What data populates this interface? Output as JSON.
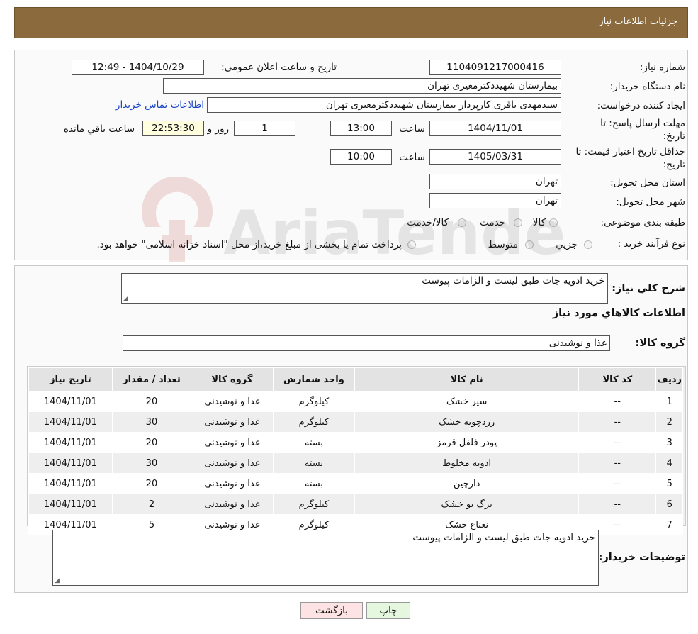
{
  "header": {
    "title": "جزئیات اطلاعات نیاز"
  },
  "form": {
    "need_number_label": "شماره نیاز:",
    "need_number": "1104091217000416",
    "announce_label": "تاریخ و ساعت اعلان عمومی:",
    "announce_value": "1404/10/29 - 12:49",
    "buyer_org_label": "نام دستگاه خریدار:",
    "buyer_org": "بیمارستان شهیددکترمعیری تهران",
    "requester_label": "ایجاد کننده درخواست:",
    "requester": "سیدمهدی باقری کارپرداز بیمارستان شهیددکترمعیری تهران",
    "contact_link": "اطلاعات تماس خریدار",
    "deadline_label_1": "مهلت ارسال پاسخ: تا",
    "deadline_label_2": "تاریخ:",
    "deadline_date": "1404/11/01",
    "time_label": "ساعت",
    "deadline_time": "13:00",
    "days_value": "1",
    "days_label": "روز و",
    "remaining_time": "22:53:30",
    "remaining_label": "ساعت باقي مانده",
    "validity_label_1": "حداقل تاریخ اعتبار قیمت: تا",
    "validity_label_2": "تاریخ:",
    "validity_date": "1405/03/31",
    "validity_time": "10:00",
    "province_label": "استان محل تحویل:",
    "province": "تهران",
    "city_label": "شهر محل تحویل:",
    "city": "تهران",
    "category_label": "طبقه بندی موضوعی:",
    "category_options": [
      "کالا",
      "خدمت",
      "کالا/خدمت"
    ],
    "process_label": "نوع فرآیند خرید :",
    "process_options": [
      "جزیي",
      "متوسط"
    ],
    "process_note": "پرداخت تمام یا بخشی از مبلغ خرید،از محل \"اسناد خزانه اسلامی\" خواهد بود."
  },
  "details": {
    "summary_label": "شرح کلي نياز:",
    "summary": "خرید ادویه جات طبق لیست و الزامات پیوست",
    "items_heading": "اطلاعات کالاهاي مورد نياز",
    "group_label": "گروه کالا:",
    "group": "غذا و نوشیدنی",
    "buyer_notes_label": "توضیحات خریدار:",
    "buyer_notes": "خرید ادویه جات طبق لیست و الزامات پیوست"
  },
  "table": {
    "headers": [
      "رديف",
      "کد کالا",
      "نام کالا",
      "واحد شمارش",
      "گروه کالا",
      "تعداد / مقدار",
      "تاریخ نیاز"
    ],
    "rows": [
      [
        "1",
        "--",
        "سیر خشک",
        "کیلوگرم",
        "غذا و نوشیدنی",
        "20",
        "1404/11/01"
      ],
      [
        "2",
        "--",
        "زردچوبه خشک",
        "کیلوگرم",
        "غذا و نوشیدنی",
        "30",
        "1404/11/01"
      ],
      [
        "3",
        "--",
        "پودر فلفل قرمز",
        "بسته",
        "غذا و نوشیدنی",
        "20",
        "1404/11/01"
      ],
      [
        "4",
        "--",
        "ادویه مخلوط",
        "بسته",
        "غذا و نوشیدنی",
        "30",
        "1404/11/01"
      ],
      [
        "5",
        "--",
        "دارچین",
        "بسته",
        "غذا و نوشیدنی",
        "20",
        "1404/11/01"
      ],
      [
        "6",
        "--",
        "برگ بو خشک",
        "کیلوگرم",
        "غذا و نوشیدنی",
        "2",
        "1404/11/01"
      ],
      [
        "7",
        "--",
        "نعناع خشک",
        "کیلوگرم",
        "غذا و نوشیدنی",
        "5",
        "1404/11/01"
      ]
    ]
  },
  "buttons": {
    "print": "چاپ",
    "back": "بازگشت"
  },
  "watermark": {
    "text": "AriaTender.neT"
  },
  "colors": {
    "header_bg": "#8b6a3e",
    "link": "#1a44c8",
    "back_button": "#fde3e3",
    "print_button": "#e6f7e0"
  }
}
